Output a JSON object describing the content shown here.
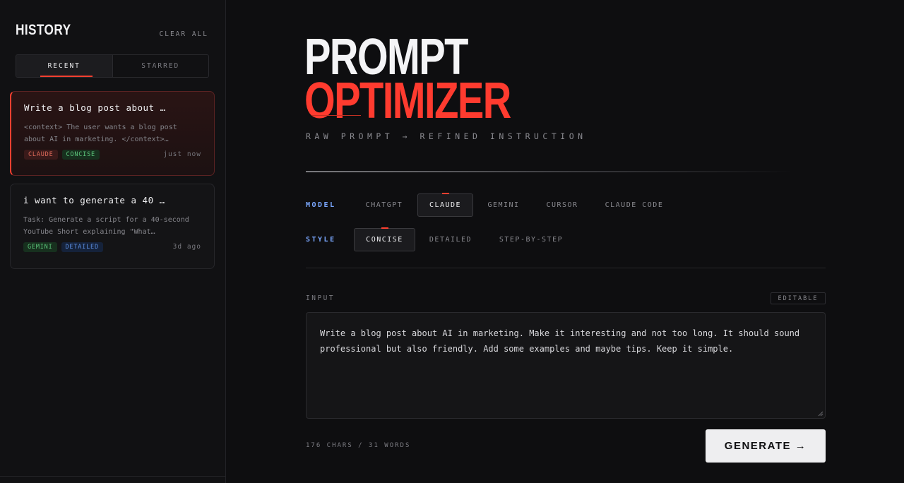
{
  "sidebar": {
    "title": "HISTORY",
    "clear_label": "CLEAR ALL",
    "tabs": [
      {
        "label": "RECENT",
        "active": true
      },
      {
        "label": "STARRED",
        "active": false
      }
    ],
    "cards": [
      {
        "title": "Write a blog post about …",
        "desc": "<context> The user wants a blog post about AI in marketing. </context>…",
        "tags": [
          "CLAUDE",
          "CONCISE"
        ],
        "time": "just now",
        "active": true
      },
      {
        "title": "i want to generate a 40 …",
        "desc": "Task: Generate a script for a 40-second YouTube Short explaining \"What…",
        "tags": [
          "GEMINI",
          "DETAILED"
        ],
        "time": "3d ago",
        "active": false
      }
    ]
  },
  "hero": {
    "line1": "PROMPT",
    "line2": "OPTIMIZER",
    "subtitle": "RAW PROMPT → REFINED INSTRUCTION"
  },
  "model": {
    "label": "MODEL",
    "options": [
      "CHATGPT",
      "CLAUDE",
      "GEMINI",
      "CURSOR",
      "CLAUDE CODE"
    ],
    "selected": "CLAUDE"
  },
  "style": {
    "label": "STYLE",
    "options": [
      "CONCISE",
      "DETAILED",
      "STEP-BY-STEP"
    ],
    "selected": "CONCISE"
  },
  "input": {
    "label": "INPUT",
    "badge": "EDITABLE",
    "value": "Write a blog post about AI in marketing. Make it interesting and not too long. It should sound professional but also friendly. Add some examples and maybe tips. Keep it simple.",
    "counter": "176 CHARS / 31 WORDS"
  },
  "generate_label": "GENERATE →",
  "colors": {
    "accent": "#ff3b2f",
    "label_blue": "#7aa7ff",
    "background": "#0e0e10"
  }
}
